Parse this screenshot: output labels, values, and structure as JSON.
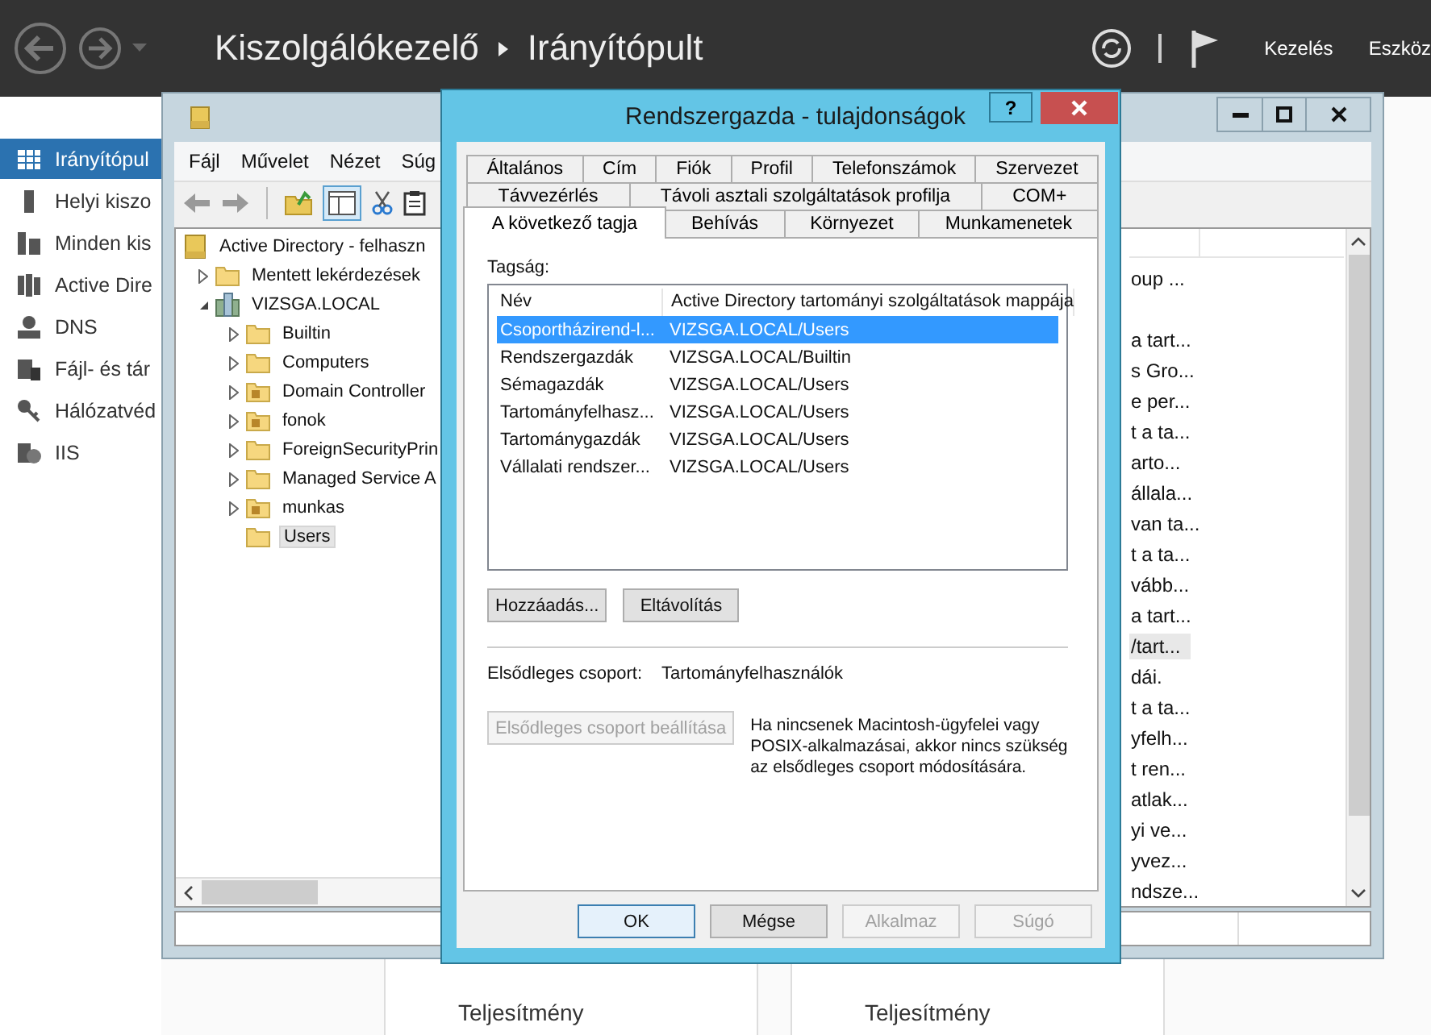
{
  "top_bar": {
    "title": "Kiszolgálókezelő",
    "breadcrumb": "Irányítópult",
    "menus": [
      "Kezelés",
      "Eszköz"
    ]
  },
  "sidebar": {
    "items": [
      {
        "label": "Irányítópul",
        "kind": "dashboard",
        "selected": true
      },
      {
        "label": "Helyi kiszo",
        "kind": "server",
        "selected": false
      },
      {
        "label": "Minden kis",
        "kind": "servers",
        "selected": false
      },
      {
        "label": "Active Dire",
        "kind": "directory",
        "selected": false
      },
      {
        "label": "DNS",
        "kind": "dns",
        "selected": false
      },
      {
        "label": "Fájl- és tár",
        "kind": "storage",
        "selected": false
      },
      {
        "label": "Hálózatvéd",
        "kind": "network",
        "selected": false
      },
      {
        "label": "IIS",
        "kind": "iis",
        "selected": false
      }
    ]
  },
  "background_tiles": [
    {
      "label": "Teljesítmény"
    },
    {
      "label": "Teljesítmény"
    }
  ],
  "aduc_window": {
    "menu": [
      "Fájl",
      "Művelet",
      "Nézet",
      "Súg"
    ],
    "tree": [
      {
        "label": "Active Directory - felhaszn",
        "kind": "snapin",
        "selected": false,
        "children": [
          {
            "label": "Mentett lekérdezések",
            "kind": "folder",
            "expanded": false,
            "selected": false
          },
          {
            "label": "VIZSGA.LOCAL",
            "kind": "domain",
            "expanded": true,
            "selected": false,
            "children": [
              {
                "label": "Builtin",
                "kind": "folder",
                "expanded": false,
                "selected": false
              },
              {
                "label": "Computers",
                "kind": "folder",
                "expanded": false,
                "selected": false
              },
              {
                "label": "Domain Controller",
                "kind": "ou",
                "expanded": false,
                "selected": false
              },
              {
                "label": "fonok",
                "kind": "ou",
                "expanded": false,
                "selected": false
              },
              {
                "label": "ForeignSecurityPrin",
                "kind": "folder",
                "expanded": false,
                "selected": false
              },
              {
                "label": "Managed Service A",
                "kind": "folder",
                "expanded": false,
                "selected": false
              },
              {
                "label": "munkas",
                "kind": "ou",
                "expanded": false,
                "selected": false
              },
              {
                "label": "Users",
                "kind": "folder",
                "selected": true
              }
            ]
          }
        ]
      }
    ],
    "list_rows": [
      {
        "text": "oup ...",
        "selected": false
      },
      {
        "text": "a tart...",
        "selected": false
      },
      {
        "text": "s Gro...",
        "selected": false
      },
      {
        "text": "e per...",
        "selected": false
      },
      {
        "text": "t a ta...",
        "selected": false
      },
      {
        "text": "arto...",
        "selected": false
      },
      {
        "text": "állala...",
        "selected": false
      },
      {
        "text": "van ta...",
        "selected": false
      },
      {
        "text": "t a ta...",
        "selected": false
      },
      {
        "text": "vább...",
        "selected": false
      },
      {
        "text": "a tart...",
        "selected": false
      },
      {
        "text": "/tart...",
        "selected": true
      },
      {
        "text": "dái.",
        "selected": false
      },
      {
        "text": "t a ta...",
        "selected": false
      },
      {
        "text": "yfelh...",
        "selected": false
      },
      {
        "text": "t ren...",
        "selected": false
      },
      {
        "text": "atlak...",
        "selected": false
      },
      {
        "text": "yi ve...",
        "selected": false
      },
      {
        "text": "yvez...",
        "selected": false
      },
      {
        "text": "ndsze...",
        "selected": false
      }
    ]
  },
  "dialog": {
    "title": "Rendszergazda - tulajdonságok",
    "help": "?",
    "tab_rows": [
      [
        {
          "label": "Általános",
          "selected": false
        },
        {
          "label": "Cím",
          "selected": false
        },
        {
          "label": "Fiók",
          "selected": false
        },
        {
          "label": "Profil",
          "selected": false
        },
        {
          "label": "Telefonszámok",
          "selected": false
        },
        {
          "label": "Szervezet",
          "selected": false
        }
      ],
      [
        {
          "label": "Távvezérlés",
          "selected": false
        },
        {
          "label": "Távoli asztali szolgáltatások profilja",
          "selected": false
        },
        {
          "label": "COM+",
          "selected": false
        }
      ],
      [
        {
          "label": "A következő tagja",
          "selected": true
        },
        {
          "label": "Behívás",
          "selected": false
        },
        {
          "label": "Környezet",
          "selected": false
        },
        {
          "label": "Munkamenetek",
          "selected": false
        }
      ]
    ],
    "membership_label": "Tagság:",
    "columns": [
      "Név",
      "Active Directory tartományi szolgáltatások mappája"
    ],
    "rows": [
      {
        "name": "Csoportházirend-l...",
        "folder": "VIZSGA.LOCAL/Users",
        "selected": true
      },
      {
        "name": "Rendszergazdák",
        "folder": "VIZSGA.LOCAL/Builtin",
        "selected": false
      },
      {
        "name": "Sémagazdák",
        "folder": "VIZSGA.LOCAL/Users",
        "selected": false
      },
      {
        "name": "Tartományfelhasz...",
        "folder": "VIZSGA.LOCAL/Users",
        "selected": false
      },
      {
        "name": "Tartománygazdák",
        "folder": "VIZSGA.LOCAL/Users",
        "selected": false
      },
      {
        "name": "Vállalati rendszer...",
        "folder": "VIZSGA.LOCAL/Users",
        "selected": false
      }
    ],
    "list_buttons": [
      {
        "label": "Hozzáadás...",
        "disabled": false
      },
      {
        "label": "Eltávolítás",
        "disabled": false
      }
    ],
    "primary_group_label": "Elsődleges csoport:",
    "primary_group_value": "Tartományfelhasználók",
    "set_primary_button": {
      "label": "Elsődleges csoport beállítása",
      "disabled": true
    },
    "note": "Ha nincsenek Macintosh-ügyfelei vagy POSIX-alkalmazásai, akkor nincs szükség az elsődleges csoport módosítására.",
    "footer_buttons": [
      {
        "label": "OK",
        "disabled": false,
        "default": true
      },
      {
        "label": "Mégse",
        "disabled": false,
        "default": false
      },
      {
        "label": "Alkalmaz",
        "disabled": true,
        "default": false
      },
      {
        "label": "Súgó",
        "disabled": true,
        "default": false
      }
    ]
  }
}
